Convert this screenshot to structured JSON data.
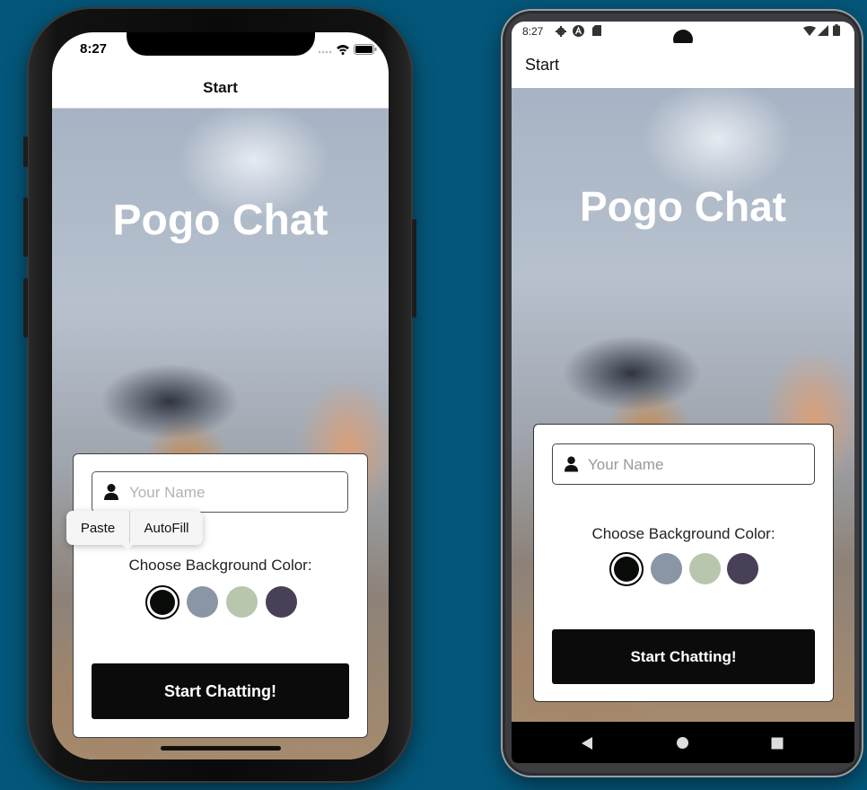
{
  "ios": {
    "status_time": "8:27",
    "header_title": "Start",
    "app_title": "Pogo Chat",
    "edit_menu": {
      "paste": "Paste",
      "autofill": "AutoFill"
    },
    "name_placeholder": "Your Name",
    "choose_color_label": "Choose Background Color:",
    "start_button": "Start Chatting!"
  },
  "android": {
    "status_time": "8:27",
    "header_title": "Start",
    "app_title": "Pogo Chat",
    "name_placeholder": "Your Name",
    "choose_color_label": "Choose Background Color:",
    "start_button": "Start Chatting!"
  },
  "colors": {
    "swatches": [
      "#090C08",
      "#8A95A5",
      "#B9C6AE",
      "#474056"
    ],
    "selected_swatch": "#090C08",
    "page_background": "#04577A"
  },
  "icons": {
    "input": "person-icon",
    "wifi": "wifi-icon",
    "battery": "battery-icon",
    "nav_back": "back-triangle-icon",
    "nav_home": "home-circle-icon",
    "nav_recents": "recents-square-icon"
  }
}
